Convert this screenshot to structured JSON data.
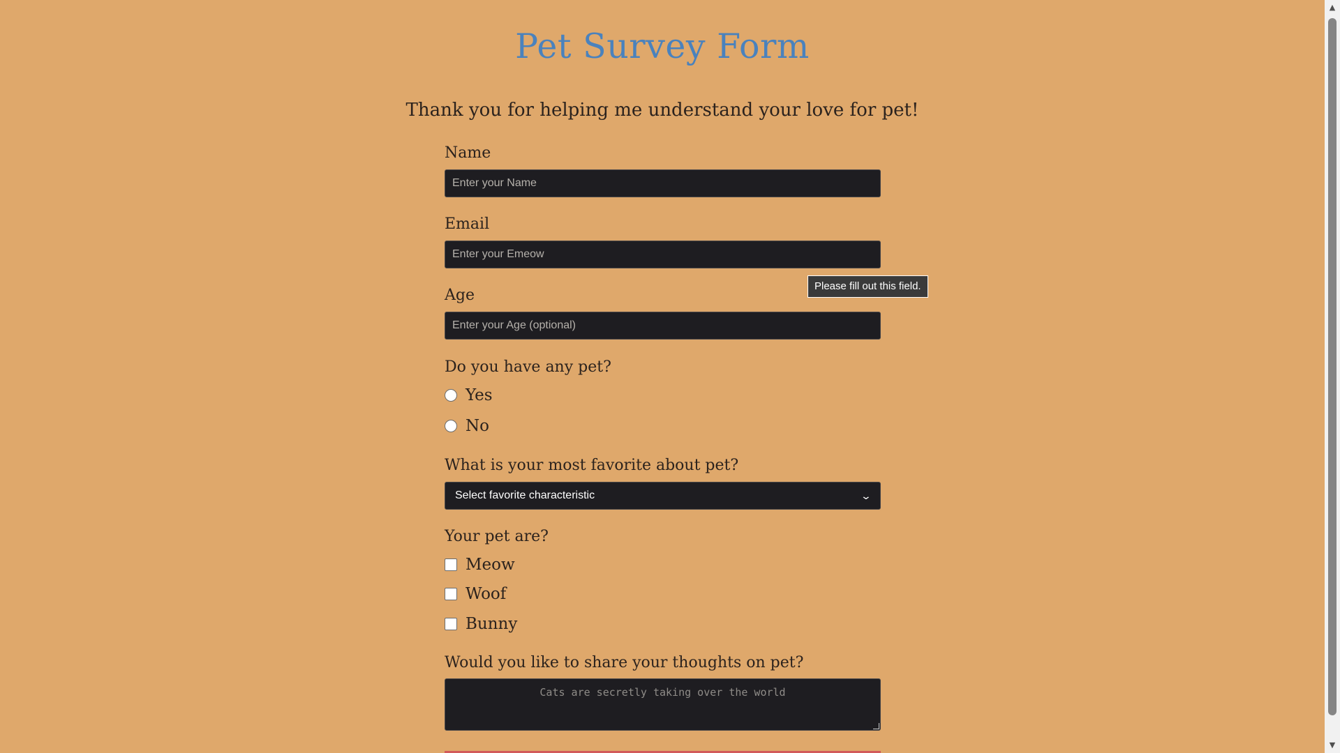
{
  "title": "Pet Survey Form",
  "description": "Thank you for helping me understand your love for pet!",
  "fields": {
    "name": {
      "label": "Name",
      "placeholder": "Enter your Name"
    },
    "email": {
      "label": "Email",
      "placeholder": "Enter your Emeow"
    },
    "age": {
      "label": "Age",
      "placeholder": "Enter your Age (optional)"
    }
  },
  "has_pet": {
    "question": "Do you have any pet?",
    "options": [
      "Yes",
      "No"
    ]
  },
  "favorite": {
    "question": "What is your most favorite about pet?",
    "selected": "Select favorite characteristic"
  },
  "pet_type": {
    "question": "Your pet are?",
    "options": [
      "Meow",
      "Woof",
      "Bunny"
    ]
  },
  "thoughts": {
    "question": "Would you like to share your thoughts on pet?",
    "placeholder": "Cats are secretly taking over the world"
  },
  "validation_tooltip": "Please fill out this field.",
  "icons": {
    "select_arrow": "chevron-down-icon",
    "scroll_up": "scroll-up-arrow-icon",
    "scroll_down": "scroll-down-arrow-icon"
  }
}
